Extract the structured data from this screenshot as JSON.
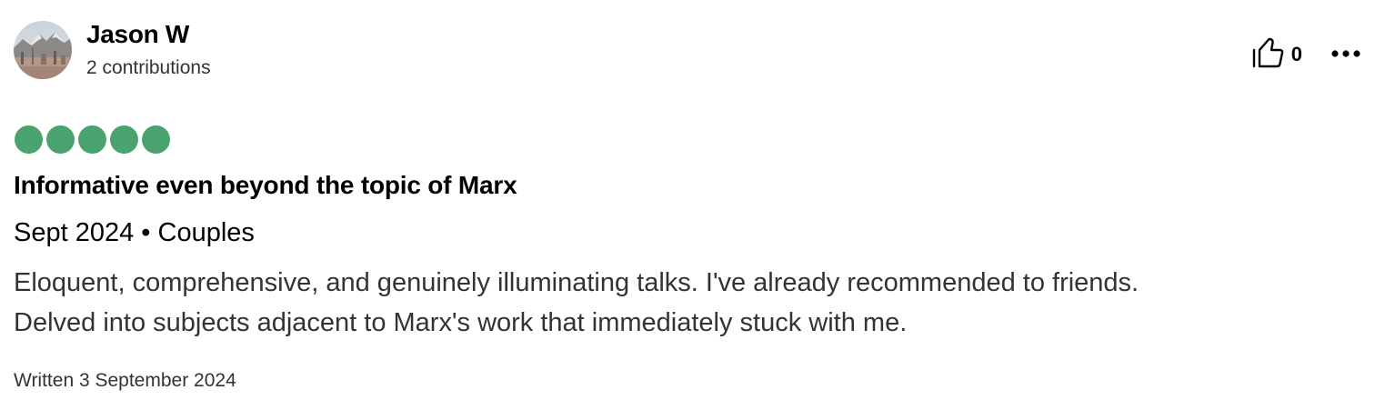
{
  "reviewer": {
    "name": "Jason W",
    "contributions": "2 contributions",
    "avatar_icon": "avatar-photo-mountains-city"
  },
  "actions": {
    "helpful_icon": "thumbs-up-icon",
    "helpful_count": "0",
    "more_icon": "more-horizontal-icon"
  },
  "rating": {
    "value": 5,
    "max": 5,
    "color": "#4aa36f"
  },
  "review": {
    "title": "Informative even beyond the topic of Marx",
    "trip_info": "Sept 2024 • Couples",
    "body_lines": [
      "Eloquent, comprehensive, and genuinely illuminating talks. I've already recommended to friends.",
      "Delved into subjects adjacent to Marx's work that immediately stuck with me."
    ],
    "written": "Written 3 September 2024"
  }
}
